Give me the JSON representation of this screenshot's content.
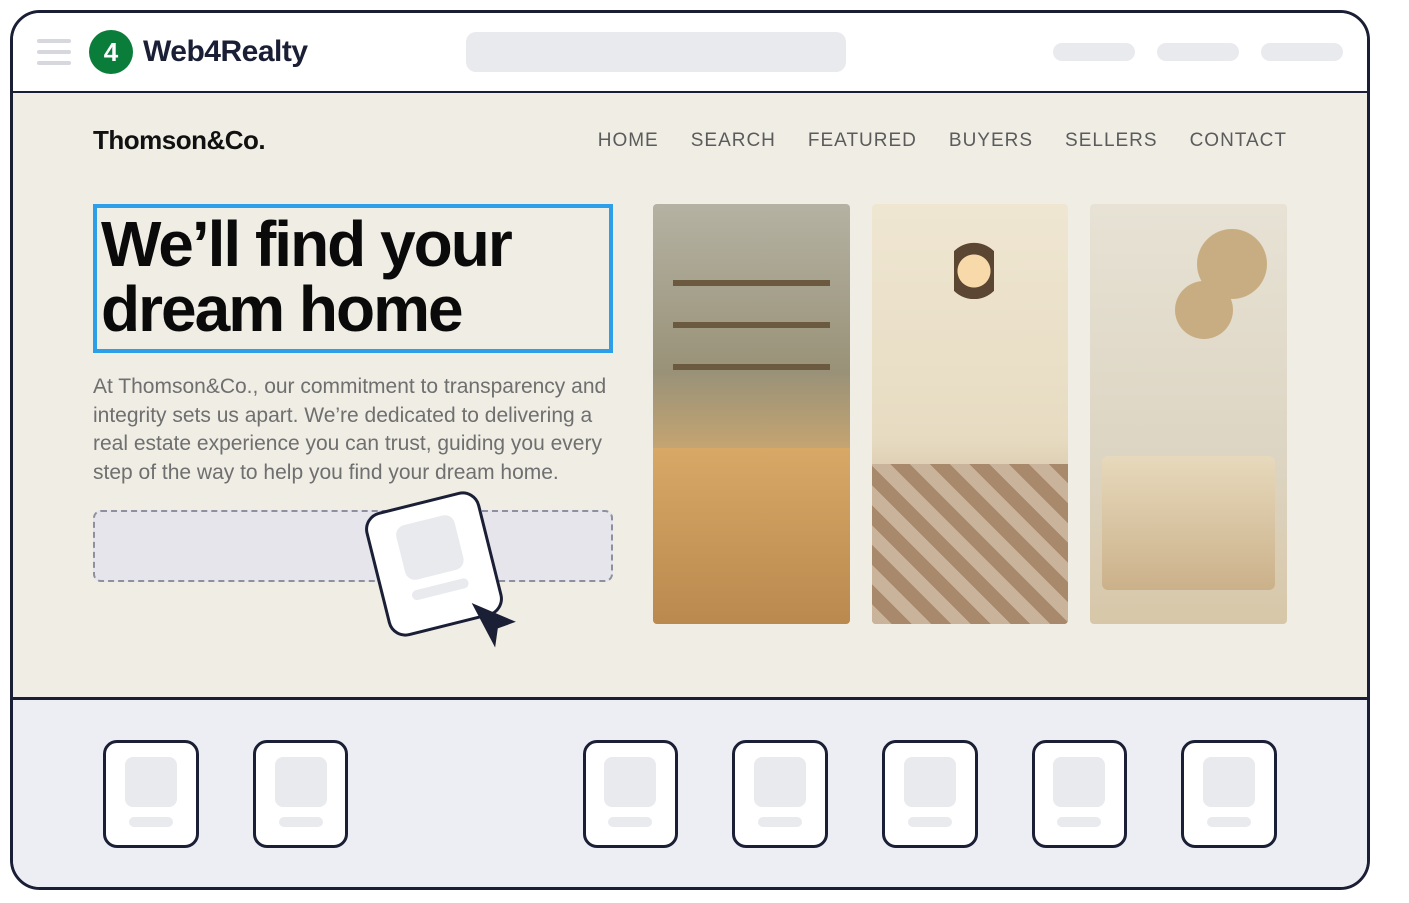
{
  "topbar": {
    "brand": "Web4Realty",
    "badge_char": "4"
  },
  "site": {
    "logo": "Thomson&Co.",
    "nav": [
      "HOME",
      "SEARCH",
      "FEATURED",
      "BUYERS",
      "SELLERS",
      "CONTACT"
    ],
    "headline": "We’ll find your dream home",
    "paragraph": "At Thomson&Co., our commitment to transparency and integrity sets us apart. We’re dedicated to delivering a real estate experience you can trust, guiding you every step of the way to help you find your dream home."
  }
}
